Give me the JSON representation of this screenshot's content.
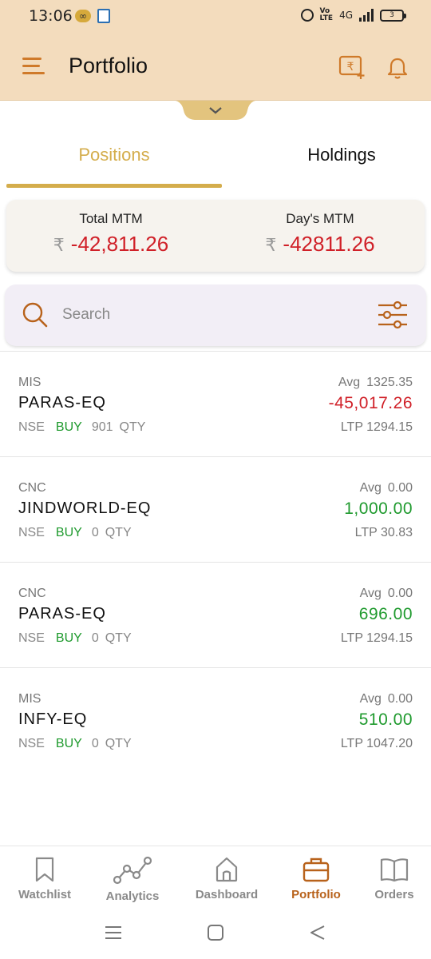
{
  "status_bar": {
    "time": "13:06",
    "network": "4G",
    "battery_level": "3"
  },
  "header": {
    "title": "Portfolio",
    "accent_color": "#cf7a2a",
    "background_color": "#f3dcbd"
  },
  "tabs": [
    {
      "label": "Positions",
      "active": true
    },
    {
      "label": "Holdings",
      "active": false
    }
  ],
  "mtm": {
    "total_label": "Total MTM",
    "total_value": "-42,811.26",
    "day_label": "Day's MTM",
    "day_value": "-42811.26",
    "currency_symbol": "₹"
  },
  "search": {
    "placeholder": "Search"
  },
  "positions": [
    {
      "product": "MIS",
      "symbol": "PARAS-EQ",
      "exchange": "NSE",
      "side": "BUY",
      "qty": "901",
      "qty_label": "QTY",
      "avg_label": "Avg",
      "avg": "1325.35",
      "pnl": "-45,017.26",
      "pnl_sign": "neg",
      "ltp": "LTP 1294.15"
    },
    {
      "product": "CNC",
      "symbol": "JINDWORLD-EQ",
      "exchange": "NSE",
      "side": "BUY",
      "qty": "0",
      "qty_label": "QTY",
      "avg_label": "Avg",
      "avg": "0.00",
      "pnl": "1,000.00",
      "pnl_sign": "pos",
      "ltp": "LTP 30.83"
    },
    {
      "product": "CNC",
      "symbol": "PARAS-EQ",
      "exchange": "NSE",
      "side": "BUY",
      "qty": "0",
      "qty_label": "QTY",
      "avg_label": "Avg",
      "avg": "0.00",
      "pnl": "696.00",
      "pnl_sign": "pos",
      "ltp": "LTP 1294.15"
    },
    {
      "product": "MIS",
      "symbol": "INFY-EQ",
      "exchange": "NSE",
      "side": "BUY",
      "qty": "0",
      "qty_label": "QTY",
      "avg_label": "Avg",
      "avg": "0.00",
      "pnl": "510.00",
      "pnl_sign": "pos",
      "ltp": "LTP 1047.20"
    }
  ],
  "bottom_nav": [
    {
      "label": "Watchlist",
      "icon": "bookmark-icon",
      "active": false
    },
    {
      "label": "Analytics",
      "icon": "analytics-icon",
      "active": false
    },
    {
      "label": "Dashboard",
      "icon": "home-icon",
      "active": false
    },
    {
      "label": "Portfolio",
      "icon": "briefcase-icon",
      "active": true
    },
    {
      "label": "Orders",
      "icon": "book-icon",
      "active": false
    }
  ],
  "colors": {
    "tab_active": "#d4ad4c",
    "negative": "#d02028",
    "positive": "#1f9a2e",
    "nav_active": "#b8621b"
  }
}
